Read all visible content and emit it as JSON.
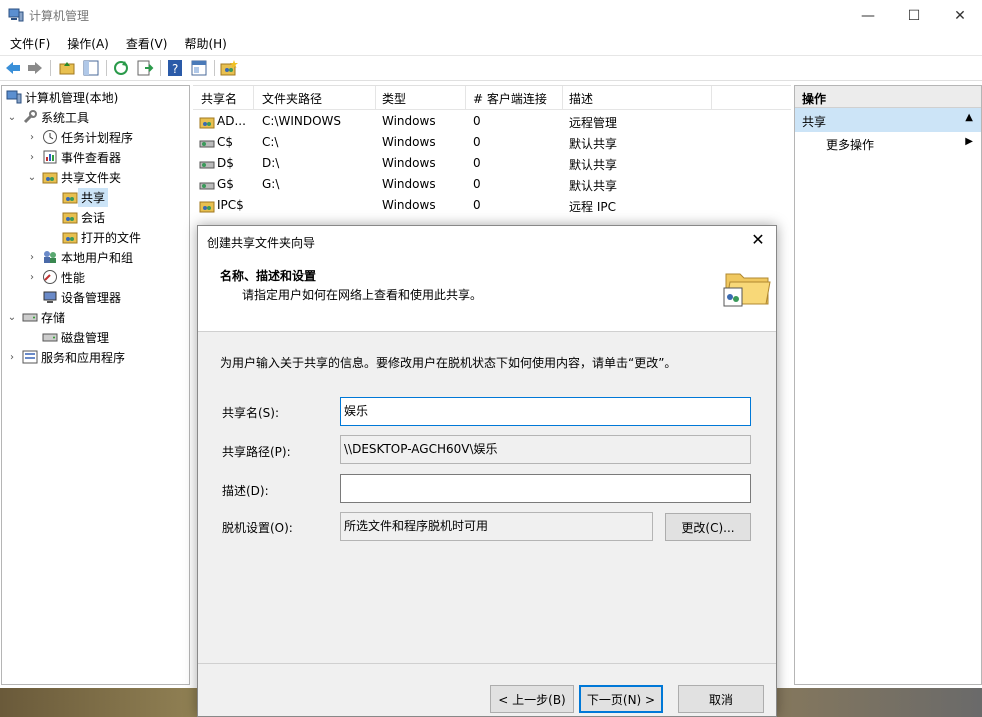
{
  "window": {
    "title": "计算机管理"
  },
  "menu": [
    "文件(F)",
    "操作(A)",
    "查看(V)",
    "帮助(H)"
  ],
  "tree": [
    {
      "label": "计算机管理(本地)"
    },
    {
      "label": "系统工具"
    },
    {
      "label": "任务计划程序"
    },
    {
      "label": "事件查看器"
    },
    {
      "label": "共享文件夹"
    },
    {
      "label": "共享"
    },
    {
      "label": "会话"
    },
    {
      "label": "打开的文件"
    },
    {
      "label": "本地用户和组"
    },
    {
      "label": "性能"
    },
    {
      "label": "设备管理器"
    },
    {
      "label": "存储"
    },
    {
      "label": "磁盘管理"
    },
    {
      "label": "服务和应用程序"
    }
  ],
  "list": {
    "columns": [
      "共享名",
      "文件夹路径",
      "类型",
      "# 客户端连接",
      "描述"
    ],
    "rows": [
      [
        "AD...",
        "C:\\WINDOWS",
        "Windows",
        "0",
        "远程管理"
      ],
      [
        "C$",
        "C:\\",
        "Windows",
        "0",
        "默认共享"
      ],
      [
        "D$",
        "D:\\",
        "Windows",
        "0",
        "默认共享"
      ],
      [
        "G$",
        "G:\\",
        "Windows",
        "0",
        "默认共享"
      ],
      [
        "IPC$",
        "",
        "Windows",
        "0",
        "远程 IPC"
      ]
    ]
  },
  "actions": {
    "header": "操作",
    "section": "共享",
    "more": "更多操作"
  },
  "dialog": {
    "title": "创建共享文件夹向导",
    "heading": "名称、描述和设置",
    "subheading": "请指定用户如何在网络上查看和使用此共享。",
    "intro": "为用户输入关于共享的信息。要修改用户在脱机状态下如何使用内容，请单击“更改”。",
    "share_name_label": "共享名(S):",
    "share_name_value": "娱乐",
    "share_path_label": "共享路径(P):",
    "share_path_value": "\\\\DESKTOP-AGCH60V\\娱乐",
    "description_label": "描述(D):",
    "description_value": "",
    "offline_label": "脱机设置(O):",
    "offline_value": "所选文件和程序脱机时可用",
    "change_button": "更改(C)...",
    "back_button": "< 上一步(B)",
    "next_button": "下一页(N) >",
    "cancel_button": "取消"
  }
}
